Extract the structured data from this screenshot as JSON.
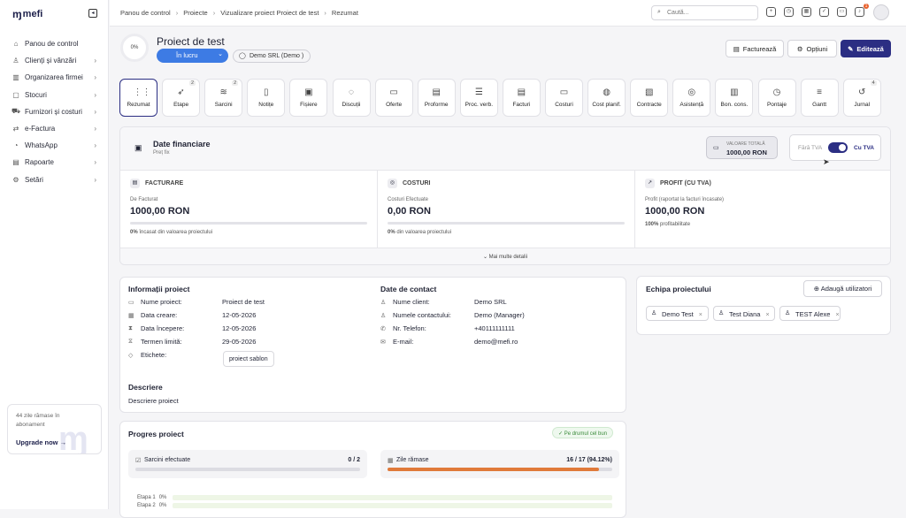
{
  "app": {
    "logo": "mefi"
  },
  "sidebar": {
    "items": [
      {
        "label": "Panou de control",
        "icon": "home-icon",
        "chev": false
      },
      {
        "label": "Clienți și vânzări",
        "icon": "users-icon",
        "chev": true
      },
      {
        "label": "Organizarea firmei",
        "icon": "building-icon",
        "chev": true
      },
      {
        "label": "Stocuri",
        "icon": "box-icon",
        "chev": true
      },
      {
        "label": "Furnizori și costuri",
        "icon": "truck-icon",
        "chev": true
      },
      {
        "label": "e-Factura",
        "icon": "efactura-icon",
        "chev": true
      },
      {
        "label": "WhatsApp",
        "icon": "whatsapp-icon",
        "chev": true
      },
      {
        "label": "Rapoarte",
        "icon": "report-icon",
        "chev": true
      },
      {
        "label": "Setări",
        "icon": "gear-icon",
        "chev": true
      }
    ],
    "upgrade": {
      "days": "44 zile rămase în abonament",
      "button": "Upgrade now"
    }
  },
  "breadcrumbs": [
    "Panou de control",
    "Proiecte",
    "Vizualizare proiect Proiect de test",
    "Rezumat"
  ],
  "search": {
    "placeholder": "Caută..."
  },
  "notifications": {
    "count": "1"
  },
  "project": {
    "progress": "0%",
    "title": "Proiect de test",
    "status": "În lucru",
    "client": "Demo SRL (Demo )"
  },
  "actions": {
    "invoice": "Facturează",
    "options": "Opțiuni",
    "edit": "Editează"
  },
  "tabs": [
    {
      "label": "Rezumat",
      "icon": "grid-icon",
      "count": ""
    },
    {
      "label": "Etape",
      "icon": "rocket-icon",
      "count": "2"
    },
    {
      "label": "Sarcini",
      "icon": "layers-icon",
      "count": "2"
    },
    {
      "label": "Notițe",
      "icon": "note-icon",
      "count": ""
    },
    {
      "label": "Fișiere",
      "icon": "file-icon",
      "count": ""
    },
    {
      "label": "Discuții",
      "icon": "chat-icon",
      "count": ""
    },
    {
      "label": "Oferte",
      "icon": "offer-icon",
      "count": ""
    },
    {
      "label": "Proforme",
      "icon": "proforma-icon",
      "count": ""
    },
    {
      "label": "Proc. verb.",
      "icon": "doc-icon",
      "count": ""
    },
    {
      "label": "Facturi",
      "icon": "invoice-icon",
      "count": ""
    },
    {
      "label": "Costuri",
      "icon": "cost-icon",
      "count": ""
    },
    {
      "label": "Cost planif.",
      "icon": "piggy-icon",
      "count": ""
    },
    {
      "label": "Contracte",
      "icon": "contract-icon",
      "count": ""
    },
    {
      "label": "Asistență",
      "icon": "support-icon",
      "count": ""
    },
    {
      "label": "Bon. cons.",
      "icon": "receipt-icon",
      "count": ""
    },
    {
      "label": "Pontaje",
      "icon": "clock-icon",
      "count": ""
    },
    {
      "label": "Gantt",
      "icon": "gantt-icon",
      "count": ""
    },
    {
      "label": "Jurnal",
      "icon": "history-icon",
      "count": "4"
    }
  ],
  "finance": {
    "title": "Date financiare",
    "subtitle": "Preț fix",
    "total_label": "VALOARE TOTALĂ",
    "total_value": "1000,00 RON",
    "vat_off": "Fără TVA",
    "vat_on": "Cu TVA",
    "vat_enabled": true,
    "cols": [
      {
        "title": "FACTURARE",
        "label": "De Facturat",
        "value": "1000,00 RON",
        "pct": "0%",
        "note": "încasat din valoarea proiectului",
        "fill": 0
      },
      {
        "title": "COSTURI",
        "label": "Costuri Efectuate",
        "value": "0,00 RON",
        "pct": "0%",
        "note": "din valoarea proiectului",
        "fill": 0
      },
      {
        "title": "PROFIT (CU TVA)",
        "label": "Profit (raportat la facturi încasate)",
        "value": "1000,00 RON",
        "pct": "100%",
        "note": "profitabilitate",
        "fill": null
      }
    ],
    "more": "Mai multe detalii"
  },
  "info": {
    "title": "Informații proiect",
    "rows": [
      {
        "k": "Nume proiect:",
        "v": "Proiect de test",
        "icon": "folder-icon"
      },
      {
        "k": "Data creare:",
        "v": "12-05-2026",
        "icon": "calendar-icon"
      },
      {
        "k": "Data începere:",
        "v": "12-05-2026",
        "icon": "hourglass-icon"
      },
      {
        "k": "Termen limită:",
        "v": "29-05-2026",
        "icon": "hourglass-end-icon"
      },
      {
        "k": "Etichete:",
        "v": "",
        "icon": "tag-icon"
      }
    ],
    "tag": "proiect sablon",
    "desc_title": "Descriere",
    "desc": "Descriere proiect"
  },
  "contact": {
    "title": "Date de contact",
    "rows": [
      {
        "k": "Nume client:",
        "v": "Demo SRL",
        "icon": "user-icon"
      },
      {
        "k": "Numele contactului:",
        "v": "Demo (Manager)",
        "icon": "user-icon"
      },
      {
        "k": "Nr. Telefon:",
        "v": "+40111111111",
        "icon": "phone-icon"
      },
      {
        "k": "E-mail:",
        "v": "demo@mefi.ro",
        "icon": "mail-icon"
      }
    ]
  },
  "team": {
    "title": "Echipa proiectului",
    "add": "Adaugă utilizatori",
    "members": [
      "Demo Test",
      "Test Diana",
      "TEST Alexe"
    ]
  },
  "progress": {
    "title": "Progres proiect",
    "status": "Pe drumul cel bun",
    "tasks": {
      "label": "Sarcini efectuate",
      "value": "0 / 2",
      "fill": 0
    },
    "days": {
      "label": "Zile rămase",
      "value": "16 / 17 (94.12%)",
      "fill": 0.9412
    },
    "stages": [
      {
        "label": "Etapa 1",
        "pct": "0%"
      },
      {
        "label": "Etapa 2",
        "pct": "0%"
      }
    ]
  },
  "colors": {
    "brand": "#2b2e83",
    "status": "#3d7be4",
    "accent": "#e07a3a"
  }
}
